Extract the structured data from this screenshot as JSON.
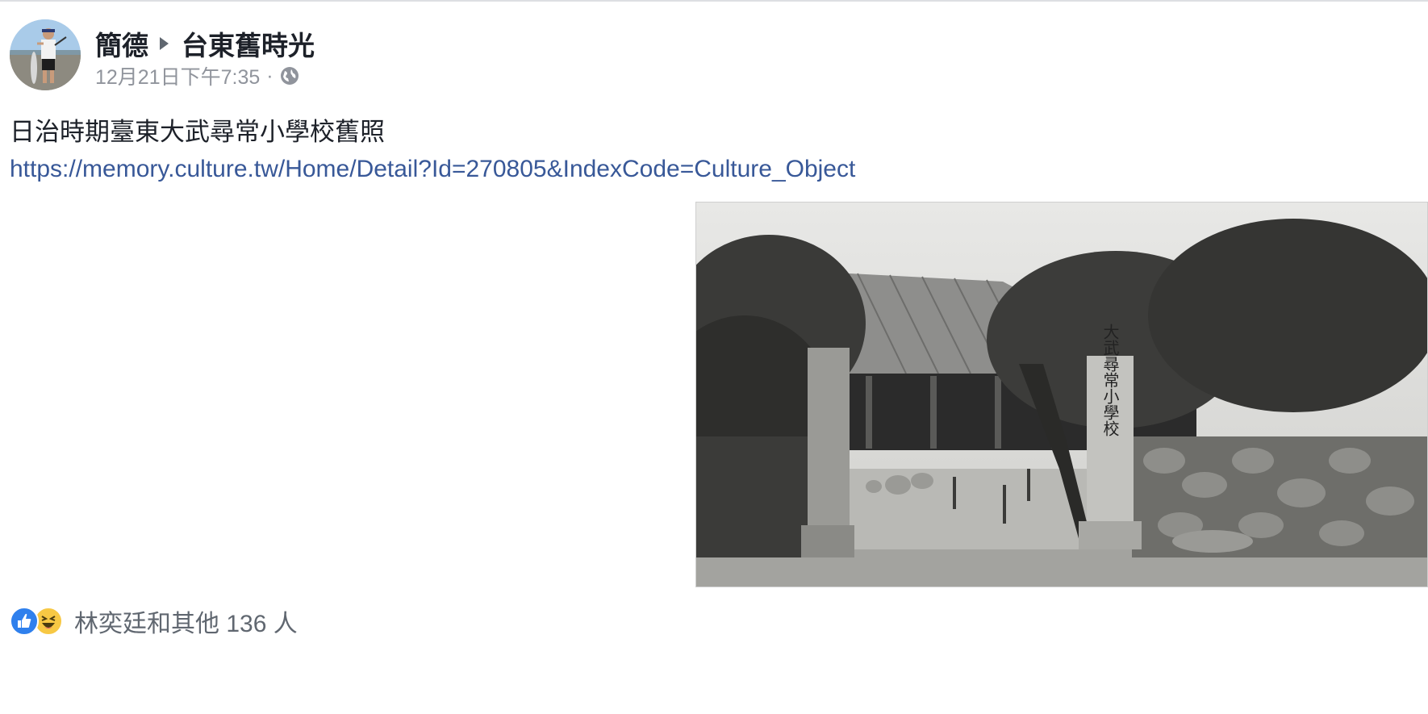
{
  "post": {
    "author": "簡德",
    "group": "台東舊時光",
    "timestamp": "12月21日下午7:35",
    "separator": "·",
    "privacy_icon": "globe-icon",
    "text": "日治時期臺東大武尋常小學校舊照",
    "link": "https://memory.culture.tw/Home/Detail?Id=270805&IndexCode=Culture_Object",
    "photo_sign_text": "大武尋常小學校"
  },
  "reactions": {
    "icons": [
      "like-icon",
      "haha-icon"
    ],
    "summary": "林奕廷和其他 136 人"
  },
  "colors": {
    "link": "#385898",
    "text": "#1d2129",
    "meta": "#90949c",
    "like_blue": "#2f80ed",
    "haha_yellow": "#f7c844"
  }
}
